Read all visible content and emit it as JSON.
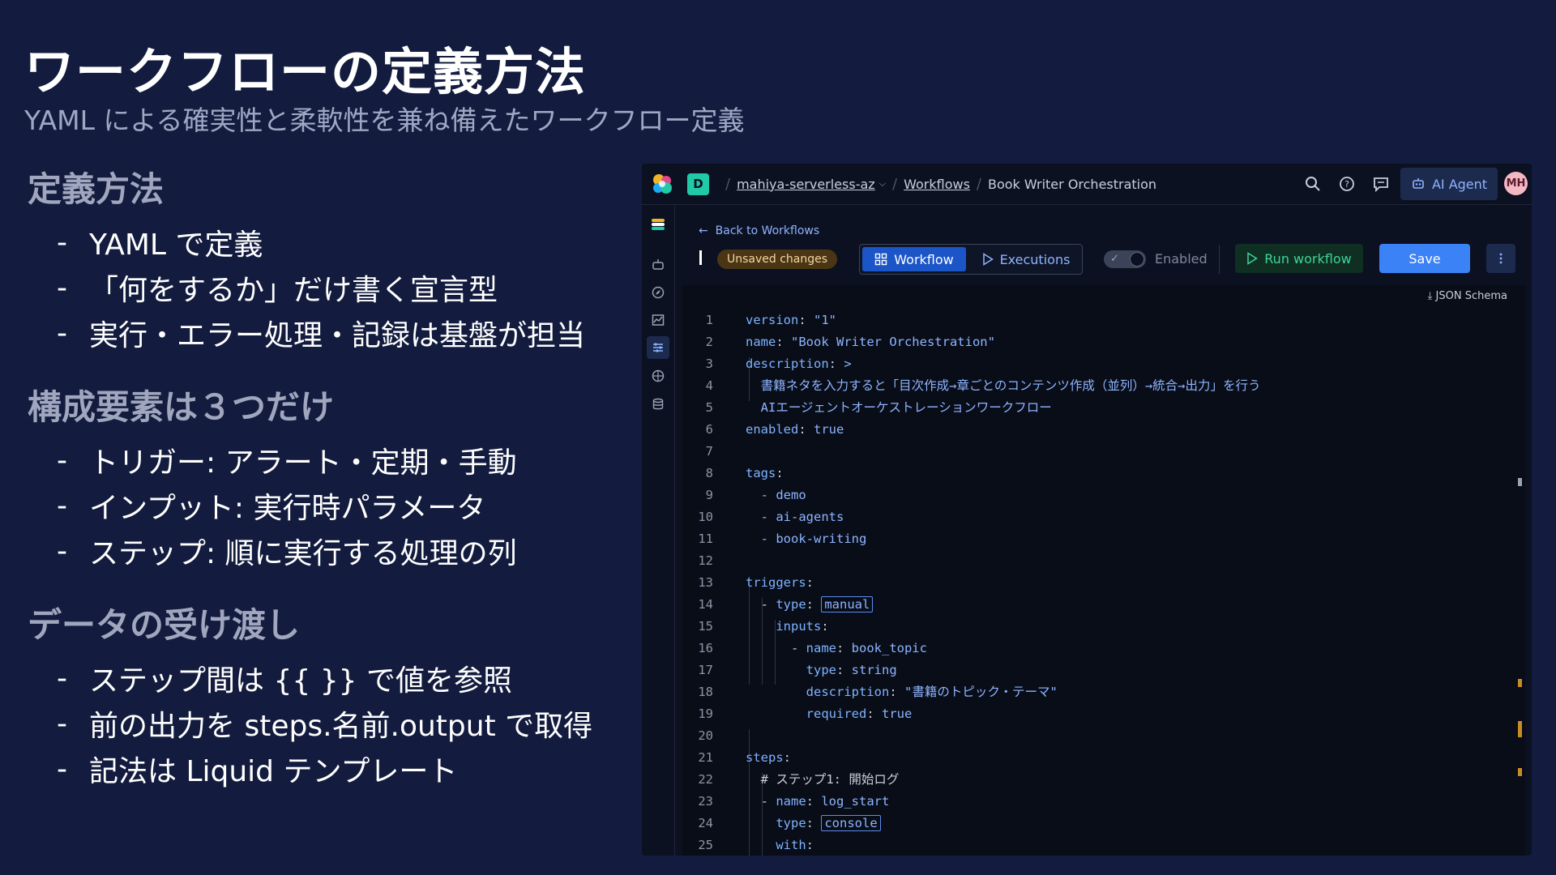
{
  "slide": {
    "title": "ワークフローの定義方法",
    "subtitle": "YAML による確実性と柔軟性を兼ね備えたワークフロー定義",
    "sections": [
      {
        "heading": "定義方法",
        "bullets": [
          "YAML で定義",
          "「何をするか」だけ書く宣言型",
          "実行・エラー処理・記録は基盤が担当"
        ]
      },
      {
        "heading": "構成要素は３つだけ",
        "bullets": [
          "トリガー: アラート・定期・手動",
          "インプット: 実行時パラメータ",
          "ステップ: 順に実行する処理の列"
        ]
      },
      {
        "heading": "データの受け渡し",
        "bullets": [
          "ステップ間は {{ }} で値を参照",
          "前の出力を steps.名前.output で取得",
          "記法は Liquid テンプレート"
        ]
      }
    ],
    "bullet_dash": "-"
  },
  "app": {
    "space_letter": "D",
    "breadcrumbs": [
      "mahiya-serverless-az",
      "Workflows",
      "Book Writer Orchestration"
    ],
    "ai_agent_label": "AI Agent",
    "avatar_initials": "MH",
    "back_label": "Back to Workflows",
    "unsaved_label": "Unsaved changes",
    "tabs": [
      "Workflow",
      "Executions"
    ],
    "enabled_label": "Enabled",
    "enabled": true,
    "run_label": "Run workflow",
    "save_label": "Save",
    "schema_label": "JSON Schema",
    "icons": {
      "search": "search-icon",
      "help": "help-icon",
      "chat": "chat-icon",
      "more": "more-vertical-icon"
    },
    "colors": {
      "accent": "#3b82f6",
      "run": "#3fd39a",
      "unsaved": "#4a3614",
      "space": "#20c9a8"
    },
    "code_lines": [
      "version: \"1\"",
      "name: \"Book Writer Orchestration\"",
      "description: >",
      "  書籍ネタを入力すると「目次作成→章ごとのコンテンツ作成（並列）→統合→出力」を行う",
      "  AIエージェントオーケストレーションワークフロー",
      "enabled: true",
      "",
      "tags:",
      "  - demo",
      "  - ai-agents",
      "  - book-writing",
      "",
      "triggers:",
      "  - type: manual",
      "    inputs:",
      "      - name: book_topic",
      "        type: string",
      "        description: \"書籍のトピック・テーマ\"",
      "        required: true",
      "",
      "steps:",
      "  # ステップ1: 開始ログ",
      "  - name: log_start",
      "    type: console",
      "    with:"
    ]
  }
}
